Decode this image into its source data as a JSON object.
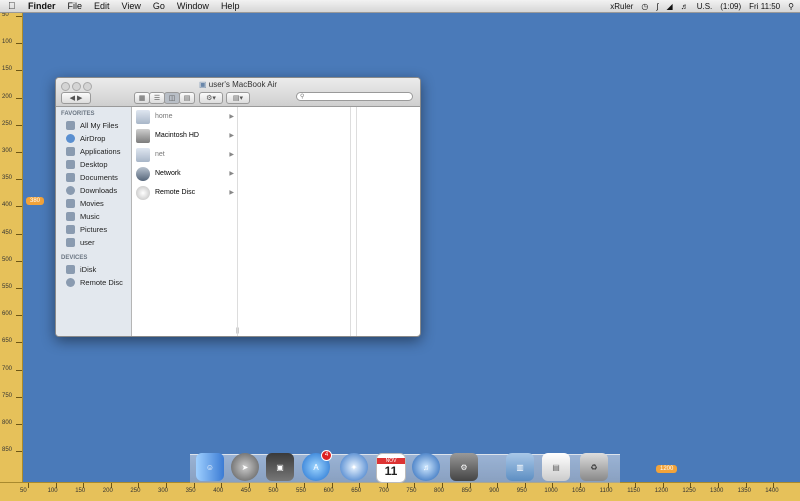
{
  "menubar": {
    "apple": "",
    "items": [
      "Finder",
      "File",
      "Edit",
      "View",
      "Go",
      "Window",
      "Help"
    ],
    "right": {
      "app": "xRuler",
      "input": "U.S.",
      "battery": "(1:09)",
      "clock": "Fri 11:50"
    }
  },
  "ruler_left": {
    "ticks": [
      "50",
      "100",
      "150",
      "200",
      "250",
      "300",
      "350",
      "400",
      "450",
      "500",
      "550",
      "600",
      "650",
      "700",
      "750",
      "800",
      "850"
    ],
    "marker": "380"
  },
  "ruler_bottom": {
    "ticks": [
      "50",
      "100",
      "150",
      "200",
      "250",
      "300",
      "350",
      "400",
      "450",
      "500",
      "550",
      "600",
      "650",
      "700",
      "750",
      "800",
      "850",
      "900",
      "950",
      "1000",
      "1050",
      "1100",
      "1150",
      "1200",
      "1250",
      "1300",
      "1350",
      "1400"
    ],
    "marker": "1200"
  },
  "finder": {
    "title": "user's MacBook Air",
    "search_placeholder": "",
    "sidebar": {
      "favorites_label": "FAVORITES",
      "favorites": [
        "All My Files",
        "AirDrop",
        "Applications",
        "Desktop",
        "Documents",
        "Downloads",
        "Movies",
        "Music",
        "Pictures",
        "user"
      ],
      "devices_label": "DEVICES",
      "devices": [
        "iDisk",
        "Remote Disc"
      ]
    },
    "column1": [
      "home",
      "Macintosh HD",
      "net",
      "Network",
      "Remote Disc"
    ]
  },
  "dock": {
    "items": [
      "Finder",
      "Launchpad",
      "Photo Browser",
      "App Store",
      "Safari",
      "Calendar",
      "iTunes",
      "System Preferences",
      "Applications",
      "Documents",
      "Trash"
    ],
    "calendar_month": "NOV",
    "calendar_day": "11",
    "app_store_badge": "4"
  }
}
